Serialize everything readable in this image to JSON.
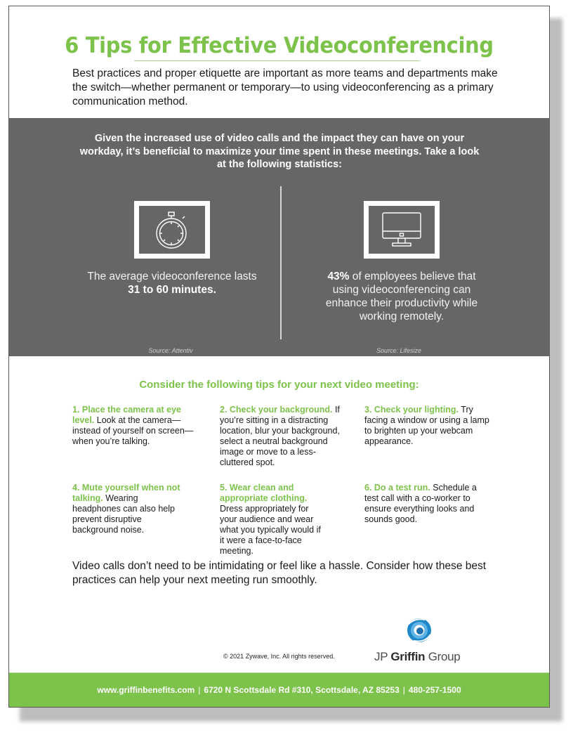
{
  "document": {
    "title": "6 Tips for Effective Videoconferencing",
    "intro": "Best practices and proper etiquette are important as more teams and departments make the switch—whether permanent or temporary—to using videoconferencing as a primary communication method.",
    "band": {
      "lead": "Given the increased use of video calls and the impact they can have on your workday, it’s beneficial to maximize your time spent in these meetings. Take a look at the following statistics:",
      "stats": [
        {
          "icon": "stopwatch-icon",
          "text_before": "The average videoconference lasts",
          "highlight": "31 to 60 minutes.",
          "text_after": "",
          "source": "Source: Attentiv"
        },
        {
          "icon": "desktop-monitor-icon",
          "text_before": "",
          "highlight": "43%",
          "text_after": "of employees believe that using videoconferencing can enhance their productivity while working remotely.",
          "source": "Source: Lifesize"
        }
      ]
    },
    "tips_heading": "Consider the following tips for your next video meeting:",
    "tips": [
      {
        "title": "1. Place the camera at eye level.",
        "body": "Look at the camera—instead of yourself on screen—when you’re talking."
      },
      {
        "title": "2. Check your background.",
        "body": "If you’re sitting in a distracting location, blur your background, select a neutral background image or move to a less-cluttered spot."
      },
      {
        "title": "3. Check your lighting.",
        "body": "Try facing a window or using a lamp to brighten up your webcam appearance."
      },
      {
        "title": "4. Mute yourself when not talking.",
        "body": "Wearing headphones can also help prevent disruptive background noise."
      },
      {
        "title": "5. Wear clean and appropriate clothing.",
        "body": "Dress appropriately for your audience and wear what you typically would if it were a face-to-face meeting."
      },
      {
        "title": "6. Do a test run.",
        "body": "Schedule a test call with a co-worker to ensure everything looks and sounds good."
      }
    ],
    "closing": "Video calls don’t need to be intimidating or feel like a hassle. Consider how these best practices can help your next meeting run smoothly.",
    "copyright": "© 2021 Zywave, Inc. All rights reserved.",
    "logo": {
      "prefix": "JP ",
      "bold": "Griffin",
      "suffix": " Group",
      "icon": "swirl-logo-icon"
    },
    "footer": {
      "website": "www.griffinbenefits.com",
      "address": "6720 N Scottsdale Rd #310, Scottsdale, AZ 85253",
      "phone": "480-257-1500",
      "separator": "|"
    },
    "colors": {
      "accent_green": "#7dc24b",
      "band_gray": "#666666",
      "logo_blue": "#1e88c8"
    }
  }
}
